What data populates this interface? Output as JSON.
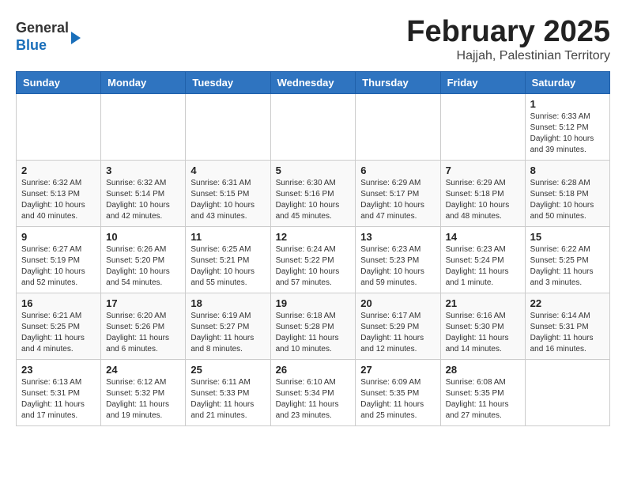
{
  "header": {
    "logo_general": "General",
    "logo_blue": "Blue",
    "month_title": "February 2025",
    "location": "Hajjah, Palestinian Territory"
  },
  "days_of_week": [
    "Sunday",
    "Monday",
    "Tuesday",
    "Wednesday",
    "Thursday",
    "Friday",
    "Saturday"
  ],
  "weeks": [
    [
      {
        "day": "",
        "info": ""
      },
      {
        "day": "",
        "info": ""
      },
      {
        "day": "",
        "info": ""
      },
      {
        "day": "",
        "info": ""
      },
      {
        "day": "",
        "info": ""
      },
      {
        "day": "",
        "info": ""
      },
      {
        "day": "1",
        "info": "Sunrise: 6:33 AM\nSunset: 5:12 PM\nDaylight: 10 hours and 39 minutes."
      }
    ],
    [
      {
        "day": "2",
        "info": "Sunrise: 6:32 AM\nSunset: 5:13 PM\nDaylight: 10 hours and 40 minutes."
      },
      {
        "day": "3",
        "info": "Sunrise: 6:32 AM\nSunset: 5:14 PM\nDaylight: 10 hours and 42 minutes."
      },
      {
        "day": "4",
        "info": "Sunrise: 6:31 AM\nSunset: 5:15 PM\nDaylight: 10 hours and 43 minutes."
      },
      {
        "day": "5",
        "info": "Sunrise: 6:30 AM\nSunset: 5:16 PM\nDaylight: 10 hours and 45 minutes."
      },
      {
        "day": "6",
        "info": "Sunrise: 6:29 AM\nSunset: 5:17 PM\nDaylight: 10 hours and 47 minutes."
      },
      {
        "day": "7",
        "info": "Sunrise: 6:29 AM\nSunset: 5:18 PM\nDaylight: 10 hours and 48 minutes."
      },
      {
        "day": "8",
        "info": "Sunrise: 6:28 AM\nSunset: 5:18 PM\nDaylight: 10 hours and 50 minutes."
      }
    ],
    [
      {
        "day": "9",
        "info": "Sunrise: 6:27 AM\nSunset: 5:19 PM\nDaylight: 10 hours and 52 minutes."
      },
      {
        "day": "10",
        "info": "Sunrise: 6:26 AM\nSunset: 5:20 PM\nDaylight: 10 hours and 54 minutes."
      },
      {
        "day": "11",
        "info": "Sunrise: 6:25 AM\nSunset: 5:21 PM\nDaylight: 10 hours and 55 minutes."
      },
      {
        "day": "12",
        "info": "Sunrise: 6:24 AM\nSunset: 5:22 PM\nDaylight: 10 hours and 57 minutes."
      },
      {
        "day": "13",
        "info": "Sunrise: 6:23 AM\nSunset: 5:23 PM\nDaylight: 10 hours and 59 minutes."
      },
      {
        "day": "14",
        "info": "Sunrise: 6:23 AM\nSunset: 5:24 PM\nDaylight: 11 hours and 1 minute."
      },
      {
        "day": "15",
        "info": "Sunrise: 6:22 AM\nSunset: 5:25 PM\nDaylight: 11 hours and 3 minutes."
      }
    ],
    [
      {
        "day": "16",
        "info": "Sunrise: 6:21 AM\nSunset: 5:25 PM\nDaylight: 11 hours and 4 minutes."
      },
      {
        "day": "17",
        "info": "Sunrise: 6:20 AM\nSunset: 5:26 PM\nDaylight: 11 hours and 6 minutes."
      },
      {
        "day": "18",
        "info": "Sunrise: 6:19 AM\nSunset: 5:27 PM\nDaylight: 11 hours and 8 minutes."
      },
      {
        "day": "19",
        "info": "Sunrise: 6:18 AM\nSunset: 5:28 PM\nDaylight: 11 hours and 10 minutes."
      },
      {
        "day": "20",
        "info": "Sunrise: 6:17 AM\nSunset: 5:29 PM\nDaylight: 11 hours and 12 minutes."
      },
      {
        "day": "21",
        "info": "Sunrise: 6:16 AM\nSunset: 5:30 PM\nDaylight: 11 hours and 14 minutes."
      },
      {
        "day": "22",
        "info": "Sunrise: 6:14 AM\nSunset: 5:31 PM\nDaylight: 11 hours and 16 minutes."
      }
    ],
    [
      {
        "day": "23",
        "info": "Sunrise: 6:13 AM\nSunset: 5:31 PM\nDaylight: 11 hours and 17 minutes."
      },
      {
        "day": "24",
        "info": "Sunrise: 6:12 AM\nSunset: 5:32 PM\nDaylight: 11 hours and 19 minutes."
      },
      {
        "day": "25",
        "info": "Sunrise: 6:11 AM\nSunset: 5:33 PM\nDaylight: 11 hours and 21 minutes."
      },
      {
        "day": "26",
        "info": "Sunrise: 6:10 AM\nSunset: 5:34 PM\nDaylight: 11 hours and 23 minutes."
      },
      {
        "day": "27",
        "info": "Sunrise: 6:09 AM\nSunset: 5:35 PM\nDaylight: 11 hours and 25 minutes."
      },
      {
        "day": "28",
        "info": "Sunrise: 6:08 AM\nSunset: 5:35 PM\nDaylight: 11 hours and 27 minutes."
      },
      {
        "day": "",
        "info": ""
      }
    ]
  ]
}
